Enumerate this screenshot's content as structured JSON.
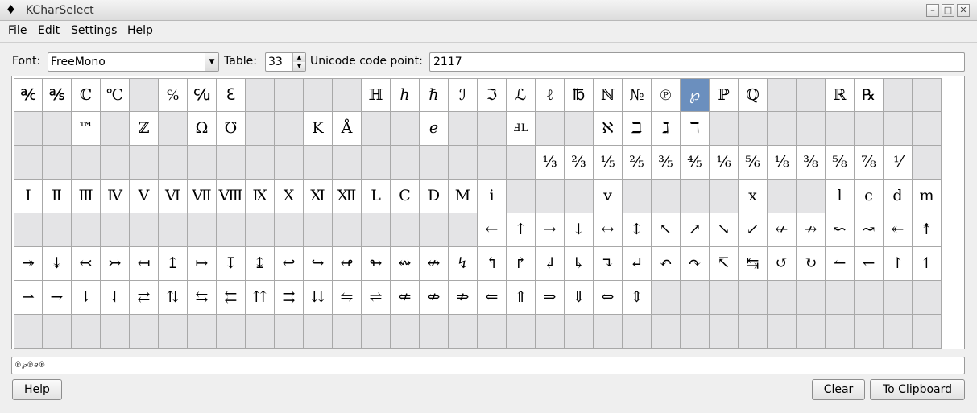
{
  "window": {
    "title": "KCharSelect",
    "minimize_glyph": "–",
    "maximize_glyph": "□",
    "close_glyph": "✕",
    "app_icon_glyph": "♦"
  },
  "menu": [
    "File",
    "Edit",
    "Settings",
    "Help"
  ],
  "font": {
    "label": "Font:",
    "value": "FreeMono"
  },
  "table": {
    "label": "Table:",
    "value": "33"
  },
  "unicode": {
    "label": "Unicode code point:",
    "value": "2117"
  },
  "grid": {
    "rows": [
      [
        "℀",
        "℁",
        "ℂ",
        "℃",
        "",
        "℅",
        "℆",
        "ℇ",
        "",
        "",
        "",
        "",
        "ℍ",
        "ℎ",
        "ℏ",
        "ℐ",
        "ℑ",
        "ℒ",
        "ℓ",
        "℔",
        "ℕ",
        "№",
        "℗",
        "℘",
        "ℙ",
        "ℚ",
        "",
        "",
        "ℝ",
        "℞",
        "",
        ""
      ],
      [
        "",
        "",
        "™",
        "",
        "ℤ",
        "",
        "Ω",
        "℧",
        "",
        "",
        "K",
        "Å",
        "",
        "",
        "ℯ",
        "",
        "",
        "ℲL",
        "",
        "",
        "ℵ",
        "ℶ",
        "ℷ",
        "ℸ",
        "",
        "",
        "",
        "",
        "",
        "",
        "",
        ""
      ],
      [
        "",
        "",
        "",
        "",
        "",
        "",
        "",
        "",
        "",
        "",
        "",
        "",
        "",
        "",
        "",
        "",
        "",
        "",
        "⅓",
        "⅔",
        "⅕",
        "⅖",
        "⅗",
        "⅘",
        "⅙",
        "⅚",
        "⅛",
        "⅜",
        "⅝",
        "⅞",
        "⅟",
        ""
      ],
      [
        "Ⅰ",
        "Ⅱ",
        "Ⅲ",
        "Ⅳ",
        "Ⅴ",
        "Ⅵ",
        "Ⅶ",
        "Ⅷ",
        "Ⅸ",
        "Ⅹ",
        "Ⅺ",
        "Ⅻ",
        "Ⅼ",
        "Ⅽ",
        "Ⅾ",
        "Ⅿ",
        "ⅰ",
        "",
        "",
        "",
        "ⅴ",
        "",
        "",
        "",
        "",
        "ⅹ",
        "",
        "",
        "ⅼ",
        "ⅽ",
        "ⅾ",
        "ⅿ"
      ],
      [
        "",
        "",
        "",
        "",
        "",
        "",
        "",
        "",
        "",
        "",
        "",
        "",
        "",
        "",
        "",
        "",
        "←",
        "↑",
        "→",
        "↓",
        "↔",
        "↕",
        "↖",
        "↗",
        "↘",
        "↙",
        "↚",
        "↛",
        "↜",
        "↝",
        "↞",
        "↟"
      ],
      [
        "↠",
        "↡",
        "↢",
        "↣",
        "↤",
        "↥",
        "↦",
        "↧",
        "↨",
        "↩",
        "↪",
        "↫",
        "↬",
        "↭",
        "↮",
        "↯",
        "↰",
        "↱",
        "↲",
        "↳",
        "↴",
        "↵",
        "↶",
        "↷",
        "↸",
        "↹",
        "↺",
        "↻",
        "↼",
        "↽",
        "↾",
        "↿"
      ],
      [
        "⇀",
        "⇁",
        "⇂",
        "⇃",
        "⇄",
        "⇅",
        "⇆",
        "⇇",
        "⇈",
        "⇉",
        "⇊",
        "⇋",
        "⇌",
        "⇍",
        "⇎",
        "⇏",
        "⇐",
        "⇑",
        "⇒",
        "⇓",
        "⇔",
        "⇕",
        "",
        "",
        "",
        "",
        "",
        "",
        "",
        "",
        "",
        ""
      ],
      [
        "",
        "",
        "",
        "",
        "",
        "",
        "",
        "",
        "",
        "",
        "",
        "",
        "",
        "",
        "",
        "",
        "",
        "",
        "",
        "",
        "",
        "",
        "",
        "",
        "",
        "",
        "",
        "",
        "",
        "",
        "",
        ""
      ]
    ],
    "selected": {
      "row": 0,
      "col": 23
    }
  },
  "preview_text": "℗℘℗ℯ℗",
  "buttons": {
    "help": "Help",
    "clear": "Clear",
    "clipboard": "To Clipboard"
  }
}
